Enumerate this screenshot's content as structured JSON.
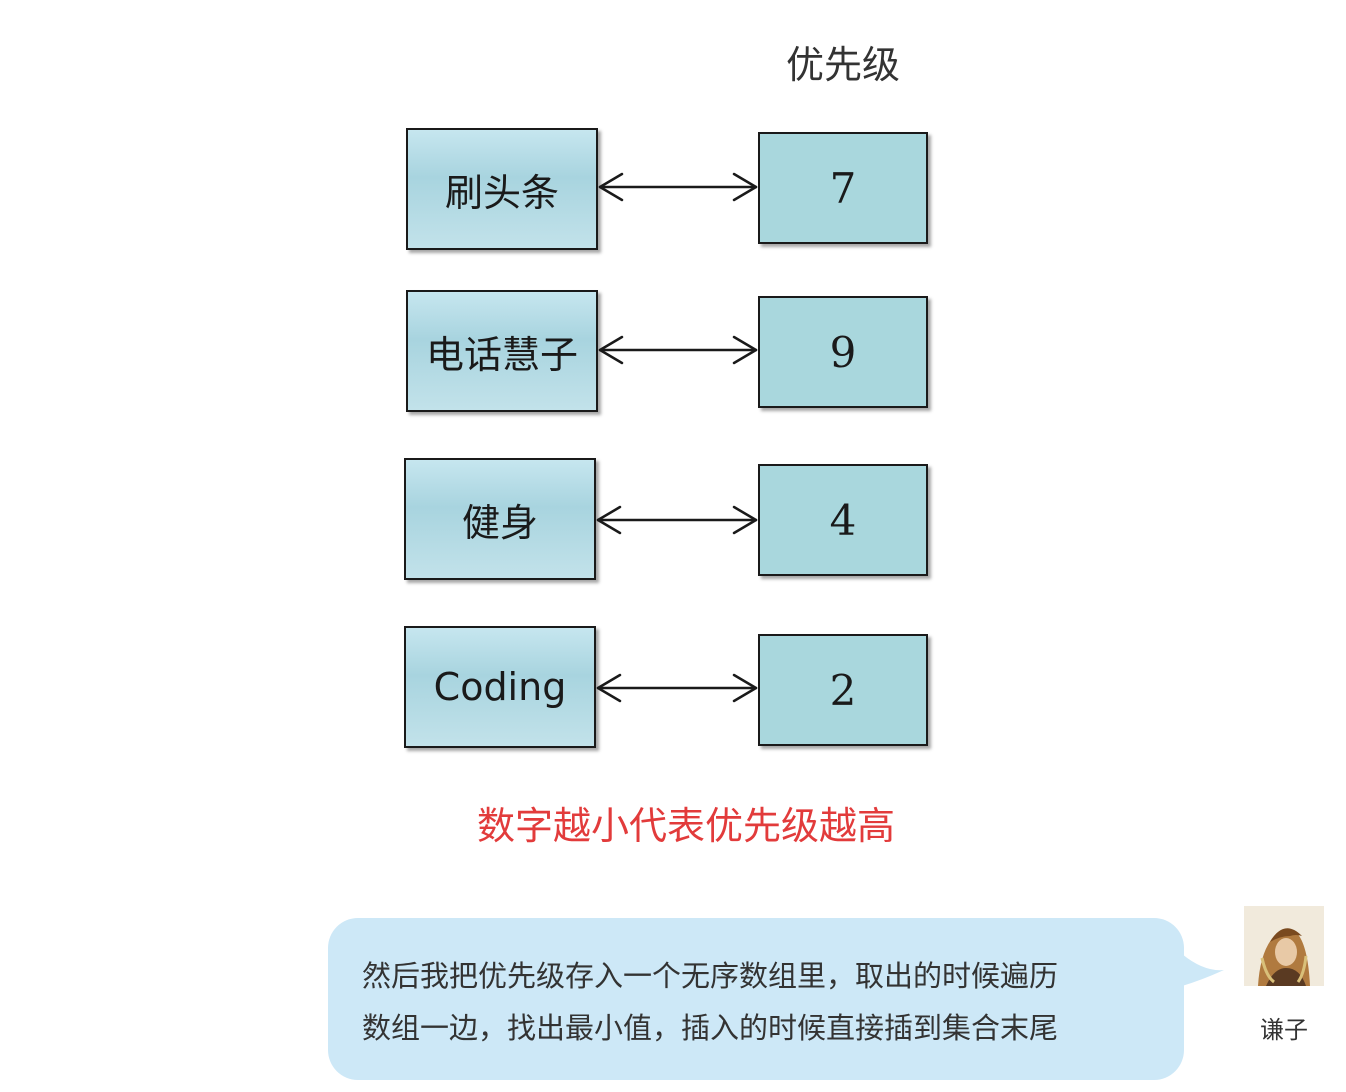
{
  "diagram": {
    "header": "优先级",
    "rows": [
      {
        "task": "刷头条",
        "priority": "7"
      },
      {
        "task": "电话慧子",
        "priority": "9"
      },
      {
        "task": "健身",
        "priority": "4"
      },
      {
        "task": "Coding",
        "priority": "2"
      }
    ],
    "note": "数字越小代表优先级越高",
    "colors": {
      "box_fill": "#a9d7dd",
      "box_border": "#1a1a1a",
      "note_text": "#e23b3b"
    }
  },
  "chat": {
    "message_lines": [
      "然后我把优先级存入一个无序数组里，取出的时候遍历",
      "数组一边，找出最小值，插入的时候直接插到集合末尾"
    ],
    "bubble_color": "#cde8f7",
    "avatar_icon": "avatar-portrait-icon",
    "sender_name": "谦子"
  }
}
